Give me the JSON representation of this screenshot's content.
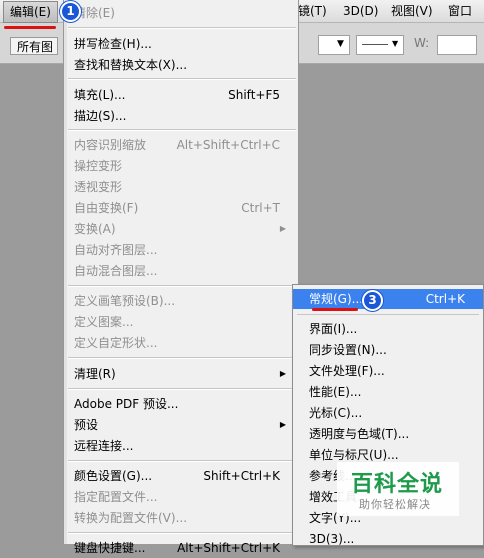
{
  "menubar": {
    "edit": "编辑(E)",
    "image": "镜(T)",
    "three_d": "3D(D)",
    "view": "视图(V)",
    "window": "窗口"
  },
  "options_bar": {
    "select_value": "所有图",
    "width_label": "W:"
  },
  "edit_menu": {
    "items": [
      {
        "label": "清除(E)",
        "shortcut": "",
        "enabled": false
      },
      {
        "label": "拼写检查(H)...",
        "shortcut": "",
        "enabled": true
      },
      {
        "label": "查找和替换文本(X)...",
        "shortcut": "",
        "enabled": true
      },
      {
        "label": "填充(L)...",
        "shortcut": "Shift+F5",
        "enabled": true
      },
      {
        "label": "描边(S)...",
        "shortcut": "",
        "enabled": true
      },
      {
        "label": "内容识别缩放",
        "shortcut": "Alt+Shift+Ctrl+C",
        "enabled": false
      },
      {
        "label": "操控变形",
        "shortcut": "",
        "enabled": false
      },
      {
        "label": "透视变形",
        "shortcut": "",
        "enabled": false
      },
      {
        "label": "自由变换(F)",
        "shortcut": "Ctrl+T",
        "enabled": false
      },
      {
        "label": "变换(A)",
        "shortcut": "",
        "enabled": false,
        "submenu": true
      },
      {
        "label": "自动对齐图层...",
        "shortcut": "",
        "enabled": false
      },
      {
        "label": "自动混合图层...",
        "shortcut": "",
        "enabled": false
      },
      {
        "label": "定义画笔预设(B)...",
        "shortcut": "",
        "enabled": false
      },
      {
        "label": "定义图案...",
        "shortcut": "",
        "enabled": false
      },
      {
        "label": "定义自定形状...",
        "shortcut": "",
        "enabled": false
      },
      {
        "label": "清理(R)",
        "shortcut": "",
        "enabled": true,
        "submenu": true
      },
      {
        "label": "Adobe PDF 预设...",
        "shortcut": "",
        "enabled": true
      },
      {
        "label": "预设",
        "shortcut": "",
        "enabled": true,
        "submenu": true
      },
      {
        "label": "远程连接...",
        "shortcut": "",
        "enabled": true
      },
      {
        "label": "颜色设置(G)...",
        "shortcut": "Shift+Ctrl+K",
        "enabled": true
      },
      {
        "label": "指定配置文件...",
        "shortcut": "",
        "enabled": false
      },
      {
        "label": "转换为配置文件(V)...",
        "shortcut": "",
        "enabled": false
      },
      {
        "label": "键盘快捷键...",
        "shortcut": "Alt+Shift+Ctrl+K",
        "enabled": true
      }
    ]
  },
  "preferences_submenu": {
    "items": [
      {
        "label": "常规(G)...",
        "shortcut": "Ctrl+K",
        "highlighted": true
      },
      {
        "label": "界面(I)...",
        "shortcut": ""
      },
      {
        "label": "同步设置(N)...",
        "shortcut": ""
      },
      {
        "label": "文件处理(F)...",
        "shortcut": ""
      },
      {
        "label": "性能(E)...",
        "shortcut": ""
      },
      {
        "label": "光标(C)...",
        "shortcut": ""
      },
      {
        "label": "透明度与色域(T)...",
        "shortcut": ""
      },
      {
        "label": "单位与标尺(U)...",
        "shortcut": ""
      },
      {
        "label": "参考线...",
        "shortcut": ""
      },
      {
        "label": "增效工具...",
        "shortcut": ""
      },
      {
        "label": "文字(Y)...",
        "shortcut": ""
      },
      {
        "label": "3D(3)...",
        "shortcut": ""
      }
    ]
  },
  "annotations": {
    "badge_1": "1",
    "badge_3": "3",
    "marker_color": "#1a57d6",
    "underline_color": "#dd1111"
  },
  "watermark": {
    "title": "百科全说",
    "subtitle": "助你轻松解决"
  },
  "colors": {
    "highlight": "#3b82ef",
    "workspace": "#9b9b9b",
    "menu_bg": "#f0f0f0"
  }
}
